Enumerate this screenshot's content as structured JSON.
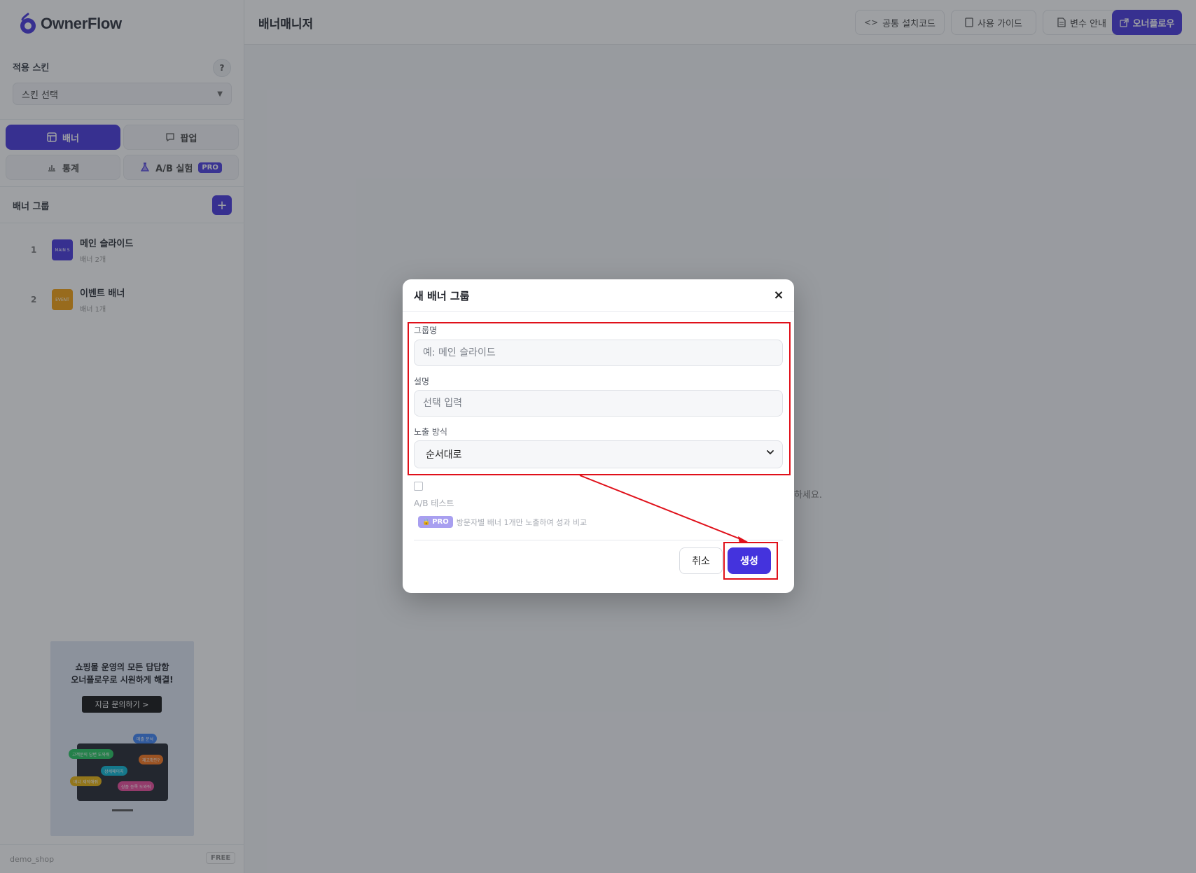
{
  "app": {
    "brand": "OwnerFlow"
  },
  "sidebar": {
    "skin_label": "적용 스킨",
    "help_label": "?",
    "skin_select_value": "스킨 선택",
    "tabs": [
      {
        "label": "배너",
        "icon": "layout-icon",
        "active": true
      },
      {
        "label": "팝업",
        "icon": "chat-icon",
        "active": false
      },
      {
        "label": "통계",
        "icon": "chart-icon",
        "active": false
      },
      {
        "label": "A/B 실험",
        "icon": "flask-icon",
        "active": false,
        "badge": "PRO"
      }
    ],
    "group_header": "배너 그룹",
    "add_label": "+",
    "groups": [
      {
        "num": "1",
        "name": "메인 슬라이드",
        "count": "배너 2개",
        "thumb_color": "#4433dd",
        "thumb_text": "MAIN S"
      },
      {
        "num": "2",
        "name": "이벤트 배너",
        "count": "배너 1개",
        "thumb_color": "#f59e0b",
        "thumb_text": "EVENT"
      }
    ],
    "promo": {
      "line1": "쇼핑몰 운영의 모든 답답함",
      "line2": "오너플로우로 시원하게 해결!",
      "cta": "지금 문의하기 >",
      "bubbles": [
        "고객문의 답변 도와줘",
        "재고확인?",
        "상세페이지",
        "배너 제작해줘",
        "매출 분석",
        "상품 등록 도와줘"
      ]
    },
    "footer": {
      "shop": "demo_shop",
      "plan": "FREE"
    }
  },
  "topbar": {
    "title": "배너매니저",
    "buttons": [
      {
        "label": "공통 설치코드",
        "icon": "code-icon"
      },
      {
        "label": "사용 가이드",
        "icon": "book-icon"
      },
      {
        "label": "변수 안내",
        "icon": "document-icon"
      },
      {
        "label": "오너플로우",
        "icon": "external-link-icon",
        "primary": true
      }
    ]
  },
  "main": {
    "empty_hint_tail": "하세요."
  },
  "modal": {
    "title": "새 배너 그룹",
    "close_label": "×",
    "fields": {
      "group_name_label": "그룹명",
      "group_name_placeholder": "예: 메인 슬라이드",
      "desc_label": "설명",
      "desc_placeholder": "선택 입력",
      "display_label": "노출 방식",
      "display_value": "순서대로"
    },
    "ab_test": {
      "checked": false,
      "label": "A/B 테스트",
      "badge": "PRO",
      "badge_icon": "lock-icon",
      "description": "방문자별 배너 1개만 노출하여 성과 비교"
    },
    "cancel_label": "취소",
    "create_label": "생성"
  },
  "colors": {
    "accent": "#4433dd",
    "annotation": "#e0101a",
    "overlay": "rgba(40,44,52,0.45)"
  }
}
